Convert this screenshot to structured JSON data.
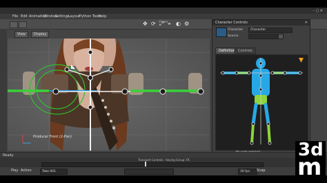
{
  "window": {
    "title": "",
    "controls": "– ▢ ✕"
  },
  "menu": [
    "File",
    "Edit",
    "Animation",
    "Window",
    "Settings",
    "Layout",
    "Python Tools",
    "Help"
  ],
  "shelf": {
    "label": "Viewer"
  },
  "view_tabs": [
    "View",
    "Display"
  ],
  "viewport": {
    "camera_label": "Producer Front (2-Pan)"
  },
  "panel": {
    "title": "Character Controls",
    "character_label": "Character",
    "character_value": "Character",
    "source_label": "Source",
    "source_value": "",
    "tabs": [
      "Definition",
      "Controls"
    ],
    "footer_left": "",
    "footer_mid": "No node selected",
    "footer_right": ""
  },
  "status": {
    "text": "Ready"
  },
  "timeline": {
    "label": "Transport Controls · Keying Group: FK"
  },
  "bottom": {
    "play_label": "Play",
    "action_label": "Action",
    "take_value": "Take 001",
    "fps_value": "30 fps",
    "snap_label": "Snap"
  },
  "logo": {
    "line1": "3d",
    "line2": "m"
  },
  "colors": {
    "accent_green": "#3dd13d",
    "accent_blue": "#1f8fe0",
    "bone_white": "#f2f2f2",
    "panel_figure_cyan": "#27a8e6",
    "panel_figure_green": "#8fd43a",
    "warning_orange": "#f1a21c"
  },
  "icons": [
    "translate-icon",
    "rotate-icon",
    "scale-icon",
    "pin-icon",
    "camera-icon",
    "settings-icon",
    "triangle-warning-icon"
  ]
}
